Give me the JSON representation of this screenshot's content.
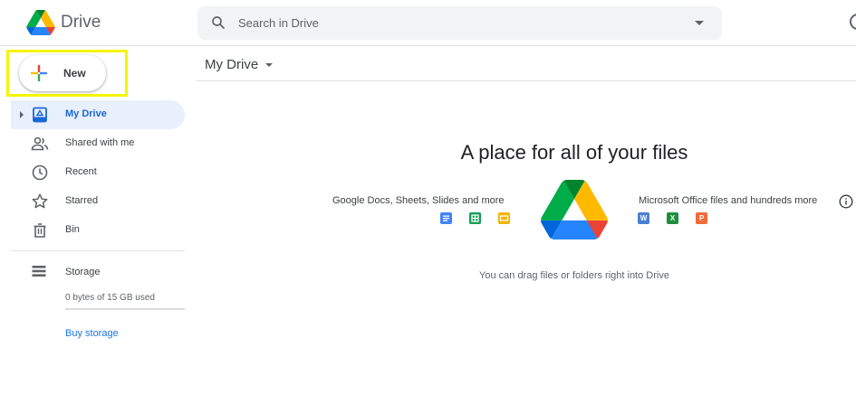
{
  "header": {
    "app_title": "Drive",
    "search_placeholder": "Search in Drive",
    "logo_icon": "google-drive-logo",
    "search_icon": "search-icon",
    "help_icon": "help-icon"
  },
  "sidebar": {
    "new_button": {
      "label": "New",
      "icon": "plus-icon",
      "highlight_color": "#f5f500"
    },
    "items": [
      {
        "label": "My Drive",
        "icon": "my-drive-icon",
        "active": true
      },
      {
        "label": "Shared with me",
        "icon": "shared-people-icon",
        "active": false
      },
      {
        "label": "Recent",
        "icon": "clock-icon",
        "active": false
      },
      {
        "label": "Starred",
        "icon": "star-icon",
        "active": false
      },
      {
        "label": "Bin",
        "icon": "trash-icon",
        "active": false
      }
    ],
    "storage": {
      "label": "Storage",
      "icon": "storage-icon",
      "used_text": "0 bytes of 15 GB used",
      "used_fraction": 0,
      "buy_label": "Buy storage"
    }
  },
  "main": {
    "breadcrumb": "My Drive",
    "empty_state": {
      "title": "A place for all of your files",
      "left_caption": "Google Docs, Sheets, Slides and more",
      "right_caption": "Microsoft Office files and hundreds more",
      "drag_hint": "You can drag files or folders right into Drive",
      "left_icons": [
        "docs-icon",
        "sheets-icon",
        "slides-icon"
      ],
      "right_icons": [
        {
          "icon": "word-icon",
          "letter": "W"
        },
        {
          "icon": "excel-icon",
          "letter": "X"
        },
        {
          "icon": "powerpoint-icon",
          "letter": "P"
        }
      ]
    }
  },
  "colors": {
    "accent": "#1a73e8",
    "active_bg": "#e8f0fe",
    "active_text": "#1967d2",
    "drive_green": "#0f9d58",
    "drive_yellow": "#f4b400",
    "drive_blue": "#4285f4",
    "word_blue": "#2b579a",
    "excel_green": "#217346",
    "powerpoint_orange": "#d24726"
  }
}
